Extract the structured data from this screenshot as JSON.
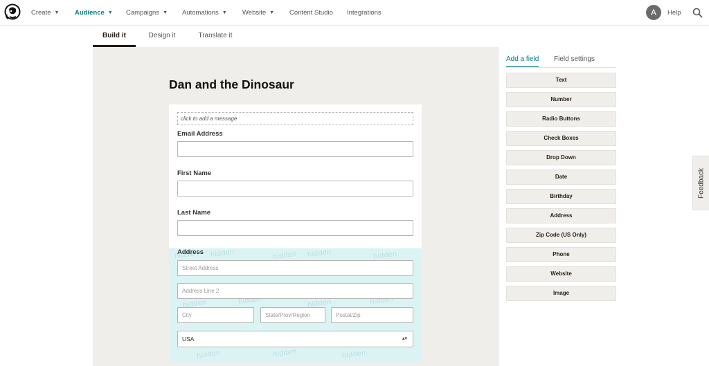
{
  "nav": {
    "items": [
      {
        "label": "Create",
        "has_caret": true
      },
      {
        "label": "Audience",
        "has_caret": true,
        "active": true
      },
      {
        "label": "Campaigns",
        "has_caret": true
      },
      {
        "label": "Automations",
        "has_caret": true
      },
      {
        "label": "Website",
        "has_caret": true
      },
      {
        "label": "Content Studio",
        "has_caret": false
      },
      {
        "label": "Integrations",
        "has_caret": false
      }
    ],
    "avatar_initial": "A",
    "help_label": "Help",
    "logo_icon": "mailchimp-freddie-icon",
    "search_icon": "search-icon"
  },
  "subtabs": [
    {
      "label": "Build it",
      "active": true
    },
    {
      "label": "Design it"
    },
    {
      "label": "Translate it"
    }
  ],
  "form": {
    "title": "Dan and the Dinosaur",
    "message_placeholder": "click to add a message",
    "fields": [
      {
        "label": "Email Address"
      },
      {
        "label": "First Name"
      },
      {
        "label": "Last Name"
      }
    ],
    "address": {
      "label": "Address",
      "watermark": "hidden",
      "street_placeholder": "Street Address",
      "line2_placeholder": "Address Line 2",
      "city_placeholder": "City",
      "state_placeholder": "State/Prov/Region",
      "zip_placeholder": "Postal/Zip",
      "country_value": "USA"
    }
  },
  "panel": {
    "tabs": [
      {
        "label": "Add a field",
        "active": true
      },
      {
        "label": "Field settings"
      }
    ],
    "field_types": [
      "Text",
      "Number",
      "Radio Buttons",
      "Check Boxes",
      "Drop Down",
      "Date",
      "Birthday",
      "Address",
      "Zip Code (US Only)",
      "Phone",
      "Website",
      "Image"
    ]
  },
  "feedback_label": "Feedback",
  "colors": {
    "accent": "#007c89",
    "canvas": "#efeeea",
    "hidden_bg": "#dcf3f4"
  }
}
